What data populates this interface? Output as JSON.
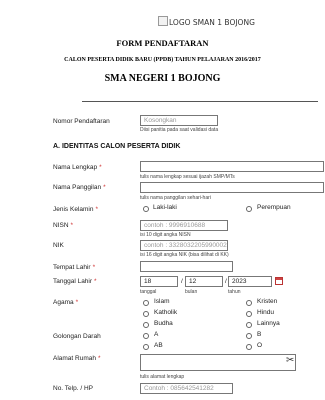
{
  "header": {
    "logo_alt": "LOGO SMAN 1 BOJONG",
    "form_title": "FORM PENDAFTARAN",
    "subtitle": "CALON PESERTA DIDIK BARU (PPDB) TAHUN PELAJARAN 2016/2017",
    "school": "SMA NEGERI 1 BOJONG"
  },
  "nomor": {
    "label": "Nomor Pendaftaran",
    "placeholder": "Kosongkan",
    "hint": "Diisi panitia pada saat validasi data"
  },
  "section_a": "A. IDENTITAS CALON PESERTA DIDIK",
  "nama_lengkap": {
    "label": "Nama Lengkap",
    "req": "*",
    "value": "",
    "hint": "tulis nama lengkap sesuai ijazah SMP/MTs"
  },
  "nama_panggilan": {
    "label": "Nama Panggilan",
    "req": "*",
    "value": "",
    "hint": "tulis nama panggilan sehari-hari"
  },
  "jenis_kelamin": {
    "label": "Jenis Kelamin",
    "req": "*",
    "options": [
      "Laki-laki",
      "Perempuan"
    ]
  },
  "nisn": {
    "label": "NISN",
    "req": "*",
    "placeholder": "contoh : 9996910688",
    "hint": "isi 10 digit angka NISN"
  },
  "nik": {
    "label": "NIK",
    "placeholder": "contoh : 3328032205990002",
    "hint": "isi 16 digit angka NIK (bisa dilihat di KK)"
  },
  "tempat_lahir": {
    "label": "Tempat Lahir",
    "req": "*",
    "value": ""
  },
  "tanggal_lahir": {
    "label": "Tanggal Lahir",
    "req": "*",
    "day": "18",
    "month": "12",
    "year": "2023",
    "sep": "/",
    "day_hint": "tanggal",
    "month_hint": "bulan",
    "year_hint": "tahun"
  },
  "agama": {
    "label": "Agama",
    "req": "*",
    "options": [
      "Islam",
      "Kristen",
      "Katholik",
      "Hindu",
      "Budha",
      "Lainnya"
    ]
  },
  "golongan_darah": {
    "label": "Golongan Darah",
    "options": [
      "A",
      "B",
      "AB",
      "O"
    ]
  },
  "alamat": {
    "label": "Alamat Rumah",
    "req": "*",
    "value": "",
    "hint": "tulis alamat lengkap"
  },
  "telp": {
    "label": "No. Telp. / HP",
    "placeholder": "Contoh : 085642541282"
  }
}
